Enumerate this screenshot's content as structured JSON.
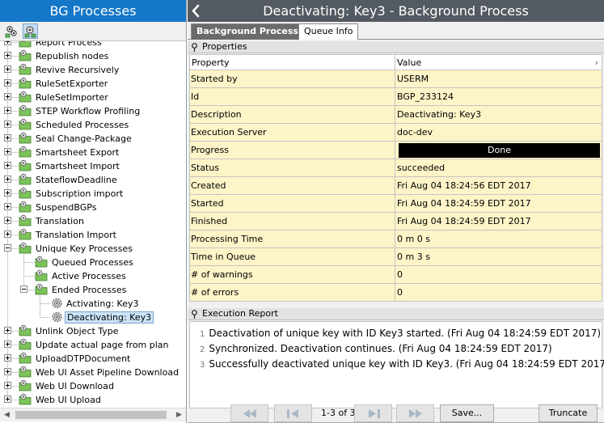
{
  "left_panel": {
    "title": "BG Processes",
    "toolbar": [
      {
        "icon": "process-group-icon"
      },
      {
        "icon": "process-tree-icon"
      }
    ],
    "tree": [
      {
        "label": "Report Process",
        "depth": 0,
        "state": "collapsed",
        "icon": "folder-gear-icon"
      },
      {
        "label": "Republish nodes",
        "depth": 0,
        "state": "collapsed",
        "icon": "folder-gear-icon"
      },
      {
        "label": "Revive Recursively",
        "depth": 0,
        "state": "collapsed",
        "icon": "folder-gear-icon"
      },
      {
        "label": "RuleSetExporter",
        "depth": 0,
        "state": "collapsed",
        "icon": "folder-gear-icon"
      },
      {
        "label": "RuleSetImporter",
        "depth": 0,
        "state": "collapsed",
        "icon": "folder-gear-icon"
      },
      {
        "label": "STEP Workflow Profiling",
        "depth": 0,
        "state": "collapsed",
        "icon": "folder-gear-icon"
      },
      {
        "label": "Scheduled Processes",
        "depth": 0,
        "state": "collapsed",
        "icon": "folder-gear-icon"
      },
      {
        "label": "Seal Change-Package",
        "depth": 0,
        "state": "collapsed",
        "icon": "folder-gear-icon"
      },
      {
        "label": "Smartsheet Export",
        "depth": 0,
        "state": "collapsed",
        "icon": "folder-gear-icon"
      },
      {
        "label": "Smartsheet Import",
        "depth": 0,
        "state": "collapsed",
        "icon": "folder-gear-icon"
      },
      {
        "label": "StateflowDeadline",
        "depth": 0,
        "state": "collapsed",
        "icon": "folder-gear-icon"
      },
      {
        "label": "Subscription import",
        "depth": 0,
        "state": "collapsed",
        "icon": "folder-gear-icon"
      },
      {
        "label": "SuspendBGPs",
        "depth": 0,
        "state": "collapsed",
        "icon": "folder-gear-icon"
      },
      {
        "label": "Translation",
        "depth": 0,
        "state": "collapsed",
        "icon": "folder-gear-icon"
      },
      {
        "label": "Translation Import",
        "depth": 0,
        "state": "collapsed",
        "icon": "folder-gear-icon"
      },
      {
        "label": "Unique Key Processes",
        "depth": 0,
        "state": "expanded",
        "icon": "folder-gear-icon"
      },
      {
        "label": "Queued Processes",
        "depth": 1,
        "state": "leaf",
        "icon": "folder-gear-icon"
      },
      {
        "label": "Active Processes",
        "depth": 1,
        "state": "leaf",
        "icon": "folder-gear-icon"
      },
      {
        "label": "Ended Processes",
        "depth": 1,
        "state": "expanded",
        "icon": "folder-gear-icon"
      },
      {
        "label": "Activating: Key3",
        "depth": 2,
        "state": "leaf",
        "icon": "gear-icon"
      },
      {
        "label": "Deactivating: Key3",
        "depth": 2,
        "state": "leaf",
        "icon": "gear-icon",
        "selected": true
      },
      {
        "label": "Unlink Object Type",
        "depth": 0,
        "state": "collapsed",
        "icon": "folder-gear-icon"
      },
      {
        "label": "Update actual page from plan",
        "depth": 0,
        "state": "collapsed",
        "icon": "folder-gear-icon"
      },
      {
        "label": "UploadDTPDocument",
        "depth": 0,
        "state": "collapsed",
        "icon": "folder-gear-icon"
      },
      {
        "label": "Web UI Asset Pipeline Download",
        "depth": 0,
        "state": "collapsed",
        "icon": "folder-gear-icon"
      },
      {
        "label": "Web UI Download",
        "depth": 0,
        "state": "collapsed",
        "icon": "folder-gear-icon"
      },
      {
        "label": "Web UI Upload",
        "depth": 0,
        "state": "collapsed",
        "icon": "folder-gear-icon"
      }
    ]
  },
  "right_panel": {
    "title": "Deactivating: Key3 - Background Process",
    "back_icon": "chevron-left-icon",
    "tabs": [
      {
        "label": "Background Process",
        "active": true
      },
      {
        "label": "Queue Info",
        "active": false
      }
    ],
    "properties": {
      "header": "Properties",
      "col_property": "Property",
      "col_value": "Value",
      "rows": [
        {
          "property": "Started by",
          "value": "USERM"
        },
        {
          "property": "Id",
          "value": "BGP_233124"
        },
        {
          "property": "Description",
          "value": "Deactivating: Key3"
        },
        {
          "property": "Execution Server",
          "value": "doc-dev"
        },
        {
          "property": "Progress",
          "value": "Done",
          "progress": 1.0
        },
        {
          "property": "Status",
          "value": "succeeded"
        },
        {
          "property": "Created",
          "value": "Fri Aug 04 18:24:56 EDT 2017"
        },
        {
          "property": "Started",
          "value": "Fri Aug 04 18:24:59 EDT 2017"
        },
        {
          "property": "Finished",
          "value": "Fri Aug 04 18:24:59 EDT 2017"
        },
        {
          "property": "Processing Time",
          "value": "0 m 0 s"
        },
        {
          "property": "Time in Queue",
          "value": "0 m 3 s"
        },
        {
          "property": "# of warnings",
          "value": "0"
        },
        {
          "property": "# of errors",
          "value": "0"
        }
      ]
    },
    "execution_report": {
      "header": "Execution Report",
      "lines": [
        {
          "num": "1",
          "text": "Deactivation of unique key with ID Key3 started. (Fri Aug 04 18:24:59 EDT 2017)"
        },
        {
          "num": "2",
          "text": "Synchronized. Deactivation continues. (Fri Aug 04 18:24:59 EDT 2017)"
        },
        {
          "num": "3",
          "text": "Successfully deactivated unique key with ID Key3. (Fri Aug 04 18:24:59 EDT 2017)"
        }
      ],
      "page_info": "1-3 of 3",
      "save_label": "Save...",
      "truncate_label": "Truncate"
    }
  },
  "colors": {
    "left_title_bg": "#1477c8",
    "right_title_bg": "#535a62",
    "row_bg": "#fdf4c8",
    "progress_bg": "#000000"
  }
}
